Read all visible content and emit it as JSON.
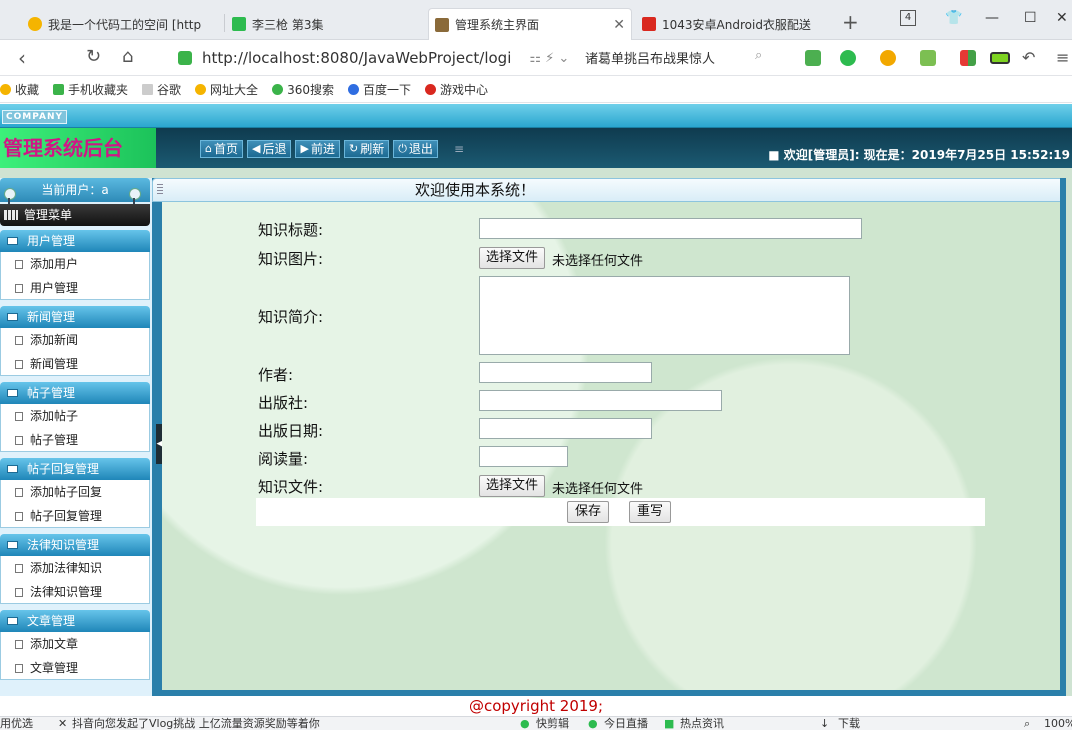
{
  "browser": {
    "tabs": [
      {
        "title": "我是一个代码工的空间 [http"
      },
      {
        "title": "李三枪 第3集"
      },
      {
        "title": "管理系统主界面"
      },
      {
        "title": "1043安卓Android衣服配送"
      }
    ],
    "tab_count": "4",
    "address": {
      "url": "http://localhost:8080/JavaWebProject/logi",
      "search_text": "诸葛单挑吕布战果惊人"
    },
    "bookmarks": [
      {
        "label": "收藏"
      },
      {
        "label": "手机收藏夹"
      },
      {
        "label": "谷歌"
      },
      {
        "label": "网址大全"
      },
      {
        "label": "360搜索"
      },
      {
        "label": "百度一下"
      },
      {
        "label": "游戏中心"
      }
    ]
  },
  "app": {
    "company": "COMPANY",
    "logo_title": "管理系统后台",
    "nav_buttons": [
      {
        "label": "首页",
        "icon": "home-icon"
      },
      {
        "label": "后退",
        "icon": "arrow-left-icon"
      },
      {
        "label": "前进",
        "icon": "arrow-right-icon"
      },
      {
        "label": "刷新",
        "icon": "refresh-icon"
      },
      {
        "label": "退出",
        "icon": "power-icon"
      }
    ],
    "welcome": "■ 欢迎[管理员]:  现在是：2019年7月25日 15:52:19"
  },
  "sidebar": {
    "current_user": "当前用户：a",
    "menu_header": "管理菜单",
    "groups": [
      {
        "title": "用户管理",
        "items": [
          "添加用户",
          "用户管理"
        ]
      },
      {
        "title": "新闻管理",
        "items": [
          "添加新闻",
          "新闻管理"
        ]
      },
      {
        "title": "帖子管理",
        "items": [
          "添加帖子",
          "帖子管理"
        ]
      },
      {
        "title": "帖子回复管理",
        "items": [
          "添加帖子回复",
          "帖子回复管理"
        ]
      },
      {
        "title": "法律知识管理",
        "items": [
          "添加法律知识",
          "法律知识管理"
        ]
      },
      {
        "title": "文章管理",
        "items": [
          "添加文章",
          "文章管理"
        ]
      }
    ]
  },
  "main": {
    "title": "欢迎使用本系统！",
    "form": {
      "title_label": "知识标题:",
      "image_label": "知识图片:",
      "intro_label": "知识简介:",
      "author_label": "作者:",
      "publisher_label": "出版社:",
      "pubdate_label": "出版日期:",
      "reads_label": "阅读量:",
      "file_label": "知识文件:",
      "choose_file": "选择文件",
      "no_file": "未选择任何文件",
      "save": "保存",
      "reset": "重写"
    },
    "footer": "@copyright 2019;"
  },
  "statusbar": {
    "left_text": "用优选",
    "news_text": "抖音向您发起了Vlog挑战 上亿流量资源奖励等着你",
    "items": [
      "快剪辑",
      "今日直播",
      "热点资讯"
    ],
    "download": "下载",
    "zoom": "100%"
  },
  "colors": {
    "header_blue": "#2aa6cf",
    "logo_green": "#1cc25a",
    "logo_text": "#d01686",
    "footer_red": "#c00000"
  }
}
